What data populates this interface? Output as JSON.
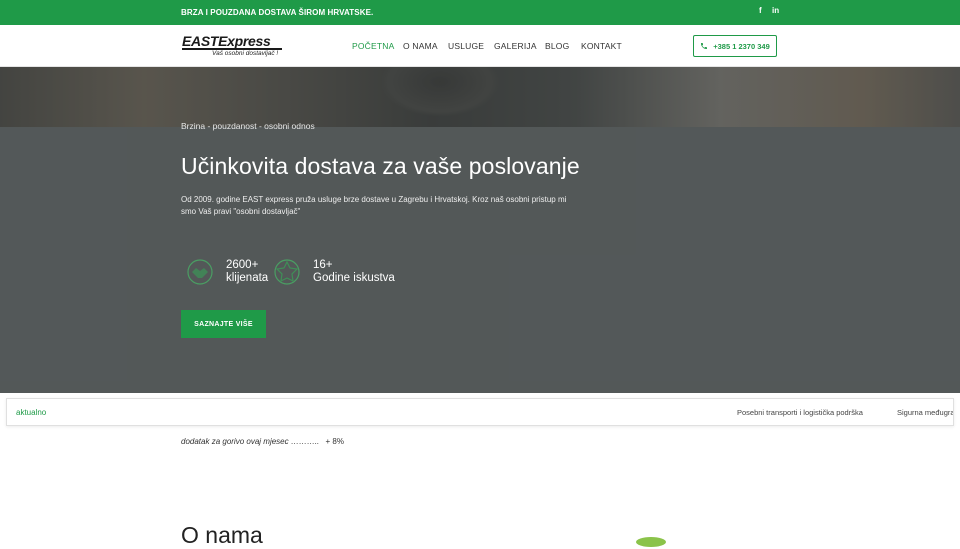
{
  "topbar": {
    "tagline": "BRZA I POUZDANA DOSTAVA ŠIROM HRVATSKE.",
    "social": [
      {
        "icon": "facebook-icon",
        "glyph": "f"
      },
      {
        "icon": "linkedin-icon",
        "glyph": "in"
      }
    ]
  },
  "header": {
    "logo": {
      "brand": "EASTExpress",
      "slogan": "Vaš osobni dostavljač !"
    },
    "nav": [
      {
        "label": "POČETNA",
        "active": true
      },
      {
        "label": "O NAMA",
        "active": false
      },
      {
        "label": "USLUGE",
        "active": false
      },
      {
        "label": "GALERIJA",
        "active": false
      },
      {
        "label": "BLOG",
        "active": false
      },
      {
        "label": "KONTAKT",
        "active": false
      }
    ],
    "phone": {
      "icon": "phone-icon",
      "label": "+385 1 2370 349"
    }
  },
  "hero": {
    "kicker": "Brzina - pouzdanost - osobni odnos",
    "title": "Učinkovita dostava za vaše poslovanje",
    "description": "Od 2009. godine EAST express pruža usluge brze dostave u Zagrebu i Hrvatskoj. Kroz naš osobni pristup mi smo Vaš pravi \"osobni dostavljač\"",
    "stats": [
      {
        "icon": "handshake-icon",
        "value": "2600+",
        "label": "klijenata"
      },
      {
        "icon": "award-icon",
        "value": "16+",
        "label": "Godine iskustva"
      }
    ],
    "cta": "SAZNAJTE VIŠE"
  },
  "ticker": {
    "label": "aktualno",
    "items": [
      "Posebni transporti i logistička podrška",
      "Sigurna međugra"
    ]
  },
  "fuel": {
    "text": "dodatak za gorivo ovaj mjesec ………..",
    "value": "+ 8%"
  },
  "about": {
    "title": "O nama"
  },
  "colors": {
    "accent": "#1f9a48",
    "hero_bg": "#55595a"
  }
}
